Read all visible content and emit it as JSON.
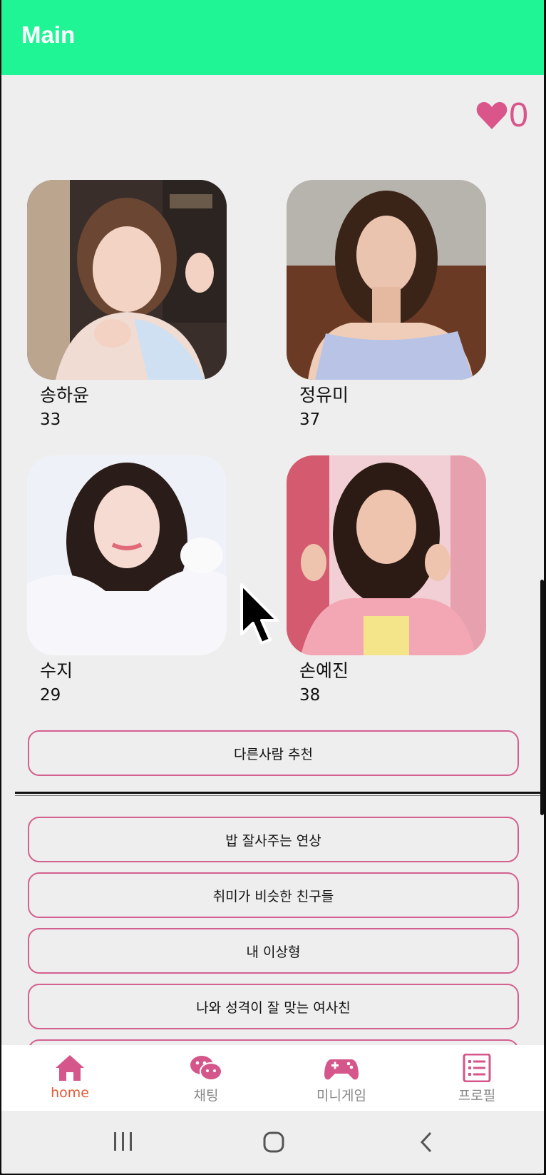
{
  "appbar": {
    "title": "Main"
  },
  "likes": {
    "count": "0"
  },
  "cards": [
    {
      "name": "송하윤",
      "age": "33"
    },
    {
      "name": "정유미",
      "age": "37"
    },
    {
      "name": "수지",
      "age": "29"
    },
    {
      "name": "손예진",
      "age": "38"
    }
  ],
  "recommend_button": "다른사람 추천",
  "categories": [
    "밥 잘사주는 연상",
    "취미가 비슷한 친구들",
    "내 이상형",
    "나와 성격이 잘 맞는 여사친"
  ],
  "nav": [
    {
      "label": "home",
      "icon": "home-icon",
      "active": true
    },
    {
      "label": "채팅",
      "icon": "chat-icon",
      "active": false
    },
    {
      "label": "미니게임",
      "icon": "gamepad-icon",
      "active": false
    },
    {
      "label": "프로필",
      "icon": "list-icon",
      "active": false
    }
  ],
  "colors": {
    "appbar": "#1ff595",
    "accent_pink": "#d3618f",
    "active_nav": "#e25b34",
    "inactive_nav": "#888888"
  }
}
